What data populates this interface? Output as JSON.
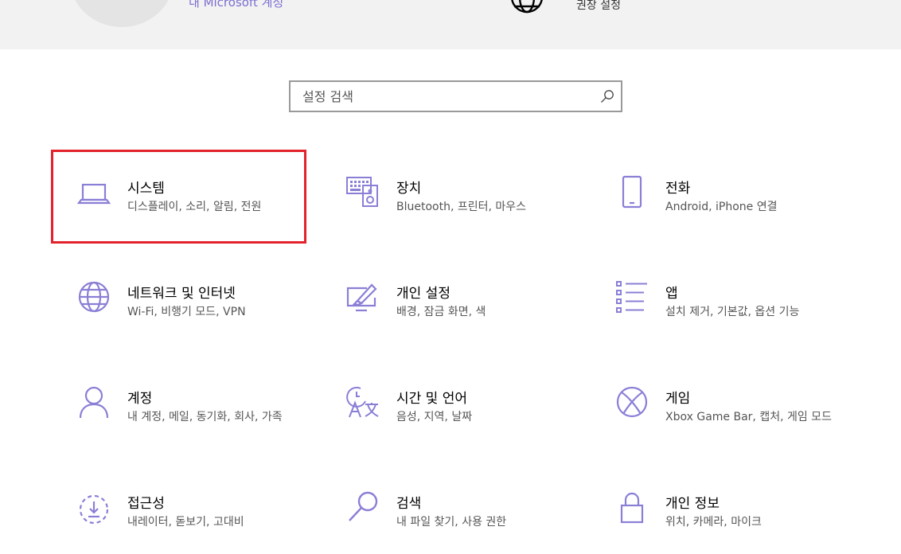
{
  "header": {
    "account_link": "내 Microsoft 계정",
    "recommend_label": "권장 설정"
  },
  "search": {
    "placeholder": "설정 검색"
  },
  "colors": {
    "accent": "#7a6fd0",
    "icon": "#8a7fd6",
    "selection": "#e3222b"
  },
  "tiles": [
    {
      "title": "시스템",
      "desc": "디스플레이, 소리, 알림, 전원",
      "icon": "laptop-icon"
    },
    {
      "title": "장치",
      "desc": "Bluetooth, 프린터, 마우스",
      "icon": "keyboard-speaker-icon"
    },
    {
      "title": "전화",
      "desc": "Android, iPhone 연결",
      "icon": "phone-icon"
    },
    {
      "title": "네트워크 및 인터넷",
      "desc": "Wi-Fi, 비행기 모드, VPN",
      "icon": "globe-icon"
    },
    {
      "title": "개인 설정",
      "desc": "배경, 잠금 화면, 색",
      "icon": "paint-monitor-icon"
    },
    {
      "title": "앱",
      "desc": "설치 제거, 기본값, 옵션 기능",
      "icon": "list-icon"
    },
    {
      "title": "계정",
      "desc": "내 계정, 메일, 동기화, 회사, 가족",
      "icon": "person-icon"
    },
    {
      "title": "시간 및 언어",
      "desc": "음성, 지역, 날짜",
      "icon": "time-language-icon"
    },
    {
      "title": "게임",
      "desc": "Xbox Game Bar, 캡처, 게임 모드",
      "icon": "xbox-icon"
    },
    {
      "title": "접근성",
      "desc": "내레이터, 돋보기, 고대비",
      "icon": "accessibility-icon"
    },
    {
      "title": "검색",
      "desc": "내 파일 찾기, 사용 권한",
      "icon": "search-icon"
    },
    {
      "title": "개인 정보",
      "desc": "위치, 카메라, 마이크",
      "icon": "lock-icon"
    }
  ]
}
